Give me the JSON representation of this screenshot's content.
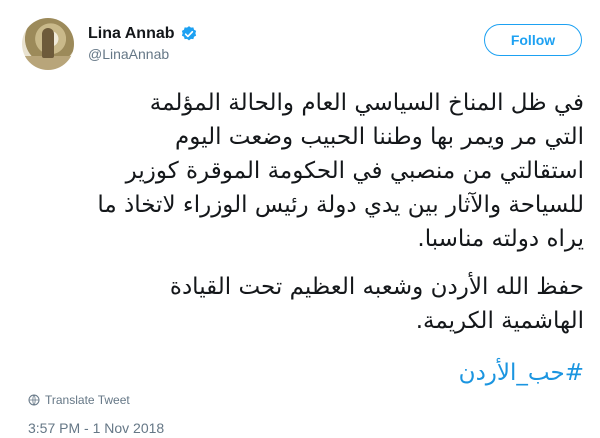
{
  "author": {
    "name": "Lina Annab",
    "handle": "@LinaAnnab",
    "verified": true
  },
  "actions": {
    "follow_label": "Follow"
  },
  "tweet": {
    "lines": [
      "في ظل المناخ السياسي العام والحالة المؤلمة",
      "التي مر ويمر بها وطننا الحبيب وضعت اليوم",
      "استقالتي من منصبي في الحكومة الموقرة كوزير",
      "للسياحة والآثار بين يدي دولة رئيس الوزراء لاتخاذ ما",
      "يراه دولته مناسبا."
    ],
    "para2_lines": [
      "حفظ الله الأردن وشعبه العظيم تحت القيادة",
      "الهاشمية الكريمة."
    ],
    "hashtag": "#حب_الأردن"
  },
  "translate_label": "Translate Tweet",
  "timestamp": "3:57 PM - 1 Nov 2018",
  "colors": {
    "accent": "#1da1f2",
    "hashtag": "#1b95e0",
    "secondary_text": "#657786"
  },
  "icons": {
    "verified": "verified-badge-icon",
    "translate": "globe-icon"
  }
}
